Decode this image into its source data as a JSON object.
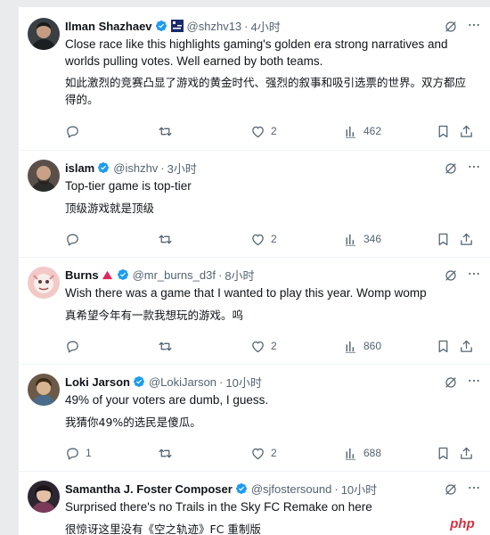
{
  "tweets": [
    {
      "name": "Ilman Shazhaev",
      "handle": "@shzhv13",
      "time": "4小时",
      "text_en": "Close race like this highlights gaming's golden era strong narratives and worlds pulling votes. Well earned by both teams.",
      "text_zh": "如此激烈的竞赛凸显了游戏的黄金时代、强烈的叙事和吸引选票的世界。双方都应得的。",
      "replies": "",
      "retweets": "",
      "likes": "2",
      "views": "462"
    },
    {
      "name": "islam",
      "handle": "@ishzhv",
      "time": "3小时",
      "text_en": "Top-tier game is top-tier",
      "text_zh": "顶级游戏就是顶级",
      "replies": "",
      "retweets": "",
      "likes": "2",
      "views": "346"
    },
    {
      "name": "Burns",
      "handle": "@mr_burns_d3f",
      "time": "8小时",
      "text_en": "Wish there was a game that I wanted to play this year. Womp womp",
      "text_zh": "真希望今年有一款我想玩的游戏。呜",
      "replies": "",
      "retweets": "",
      "likes": "2",
      "views": "860"
    },
    {
      "name": "Loki Jarson",
      "handle": "@LokiJarson",
      "time": "10小时",
      "text_en": "49% of your voters are dumb, I guess.",
      "text_zh": "我猜你49%的选民是傻瓜。",
      "replies": "1",
      "retweets": "",
      "likes": "2",
      "views": "688"
    },
    {
      "name": "Samantha J. Foster Composer",
      "handle": "@sjfostersound",
      "time": "10小时",
      "text_en": "Surprised there's no Trails in the Sky FC Remake on here",
      "text_zh": "很惊讶这里没有《空之轨迹》FC 重制版",
      "replies": "",
      "retweets": "",
      "likes": "",
      "views": ""
    }
  ],
  "watermark": "php",
  "separator": "·",
  "colors": {
    "verified": "#1d9bf0",
    "text": "#0f1419",
    "secondary": "#536471",
    "divider": "#eff3f4"
  },
  "icons": [
    "verified-badge-icon",
    "grok-icon",
    "more-icon",
    "reply-icon",
    "retweet-icon",
    "like-icon",
    "views-icon",
    "bookmark-icon",
    "share-icon"
  ]
}
